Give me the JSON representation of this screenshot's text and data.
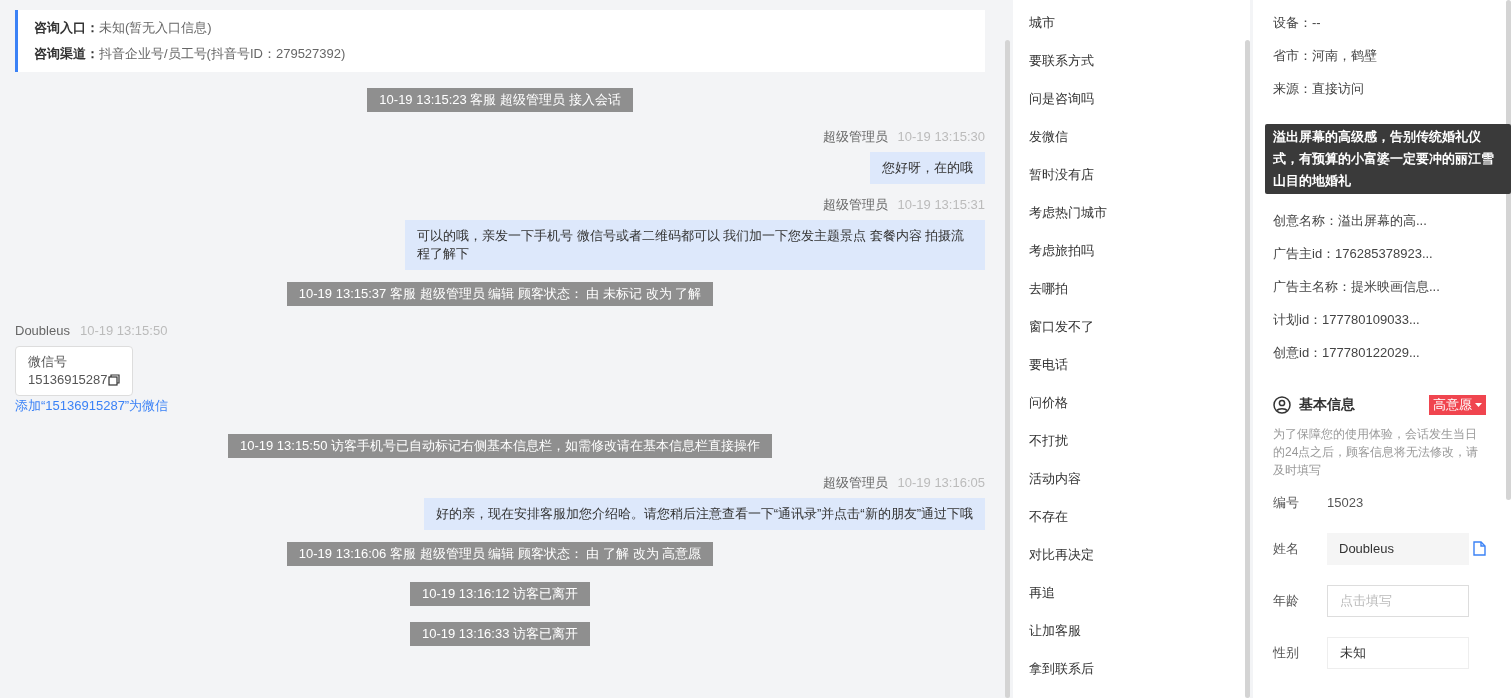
{
  "header": {
    "rows": [
      {
        "label": "咨询入口：",
        "value": "未知(暂无入口信息)"
      },
      {
        "label": "咨询渠道：",
        "value": "抖音企业号/员工号(抖音号ID：279527392)"
      }
    ]
  },
  "messages": [
    {
      "kind": "system",
      "text": "10-19 13:15:23 客服 超级管理员 接入会话"
    },
    {
      "kind": "agent",
      "sender": "超级管理员",
      "time": "10-19 13:15:30",
      "text": "您好呀，在的哦"
    },
    {
      "kind": "agent",
      "sender": "超级管理员",
      "time": "10-19 13:15:31",
      "text": "可以的哦，亲发一下手机号 微信号或者二维码都可以 我们加一下您发主题景点 套餐内容 拍摄流程了解下"
    },
    {
      "kind": "system",
      "text": "10-19 13:15:37 客服 超级管理员 编辑 顾客状态： 由 未标记 改为 了解"
    },
    {
      "kind": "visitor_card",
      "sender": "Doubleus",
      "time": "10-19 13:15:50",
      "card_title": "微信号",
      "card_value": "15136915287",
      "link": "添加“15136915287”为微信"
    },
    {
      "kind": "system",
      "text": "10-19 13:15:50 访客手机号已自动标记右侧基本信息栏，如需修改请在基本信息栏直接操作"
    },
    {
      "kind": "agent",
      "sender": "超级管理员",
      "time": "10-19 13:16:05",
      "text": "好的亲，现在安排客服加您介绍哈。请您稍后注意查看一下“通讯录”并点击“新的朋友”通过下哦"
    },
    {
      "kind": "system",
      "text": "10-19 13:16:06 客服 超级管理员 编辑 顾客状态： 由 了解 改为 高意愿"
    },
    {
      "kind": "system",
      "text": "10-19 13:16:12 访客已离开"
    },
    {
      "kind": "system",
      "text": "10-19 13:16:33 访客已离开"
    }
  ],
  "quick_replies": [
    "城市",
    "要联系方式",
    "问是咨询吗",
    "发微信",
    "暂时没有店",
    "考虑热门城市",
    "考虑旅拍吗",
    "去哪拍",
    "窗口发不了",
    "要电话",
    "问价格",
    "不打扰",
    "活动内容",
    "不存在",
    "对比再决定",
    "再追",
    "让加客服",
    "拿到联系后"
  ],
  "visitor_info": [
    "设备：--",
    "省市：河南，鹤壁",
    "来源：直接访问",
    "创意名称：溢出屏幕的高...",
    "广告主id：176285378923...",
    "广告主名称：提米映画信息...",
    "计划id：177780109033...",
    "创意id：177780122029..."
  ],
  "tooltip": "溢出屏幕的高级感，告别传统婚礼仪式，有预算的小富婆一定要冲的丽江雪山目的地婚礼",
  "basic_info": {
    "title": "基本信息",
    "tag": "高意愿",
    "notice": "为了保障您的使用体验，会话发生当日的24点之后，顾客信息将无法修改，请及时填写",
    "fields": [
      {
        "kind": "text",
        "label": "编号",
        "value": "15023"
      },
      {
        "kind": "readonly",
        "label": "姓名",
        "value": "Doubleus"
      },
      {
        "kind": "input",
        "label": "年龄",
        "placeholder": "点击填写"
      },
      {
        "kind": "select",
        "label": "性别",
        "value": "未知"
      }
    ]
  }
}
